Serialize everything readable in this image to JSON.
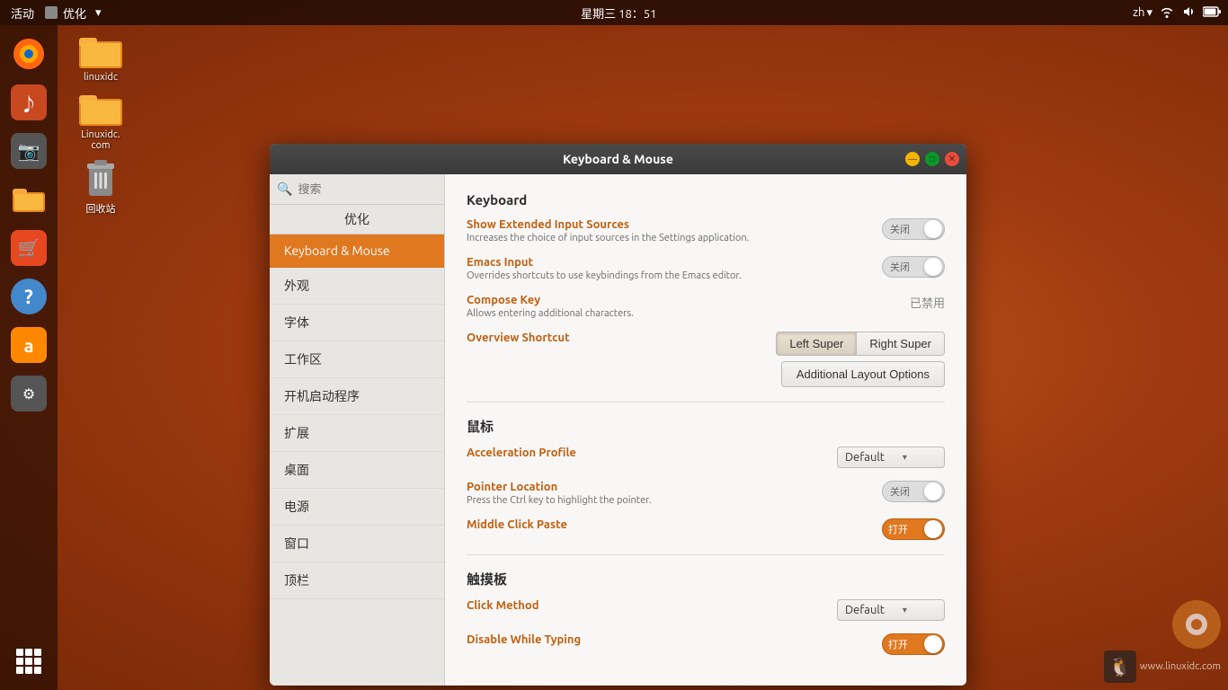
{
  "topbar": {
    "activities": "活动",
    "app_menu": "优化",
    "app_menu_arrow": "▾",
    "datetime": "星期三 18：51",
    "lang": "zh",
    "lang_arrow": "▾",
    "wifi_icon": "wifi",
    "volume_icon": "volume",
    "battery_icon": "battery"
  },
  "dock": {
    "items": [
      {
        "icon": "🦊",
        "label": ""
      },
      {
        "icon": "🔊",
        "label": ""
      },
      {
        "icon": "📷",
        "label": ""
      },
      {
        "icon": "📁",
        "label": ""
      },
      {
        "icon": "🛒",
        "label": ""
      },
      {
        "icon": "❓",
        "label": ""
      },
      {
        "icon": "🅰",
        "label": ""
      },
      {
        "icon": "⚙",
        "label": ""
      },
      {
        "icon": "⋮⋮⋮",
        "label": ""
      }
    ]
  },
  "desktop_icons": [
    {
      "label": "linuxidc",
      "type": "folder"
    },
    {
      "label": "Linuxidc.\ncom",
      "type": "folder"
    },
    {
      "label": "回收站",
      "type": "trash"
    }
  ],
  "dialog": {
    "titlebar": {
      "title": "Keyboard & Mouse"
    },
    "sidebar": {
      "search_placeholder": "搜索",
      "app_name": "优化",
      "nav_items": [
        {
          "id": "keyboard-mouse",
          "label": "Keyboard & Mouse",
          "active": true
        },
        {
          "id": "appearance",
          "label": "外观",
          "active": false
        },
        {
          "id": "fonts",
          "label": "字体",
          "active": false
        },
        {
          "id": "workspaces",
          "label": "工作区",
          "active": false
        },
        {
          "id": "startup",
          "label": "开机启动程序",
          "active": false
        },
        {
          "id": "extensions",
          "label": "扩展",
          "active": false
        },
        {
          "id": "desktop",
          "label": "桌面",
          "active": false
        },
        {
          "id": "power",
          "label": "电源",
          "active": false
        },
        {
          "id": "window",
          "label": "窗口",
          "active": false
        },
        {
          "id": "topbar",
          "label": "顶栏",
          "active": false
        }
      ]
    },
    "content": {
      "keyboard_section": "Keyboard",
      "settings": [
        {
          "id": "show-extended-input",
          "label": "Show Extended Input Sources",
          "desc": "Increases the choice of input sources in the Settings application.",
          "control": "toggle-off",
          "control_label": "关闭"
        },
        {
          "id": "emacs-input",
          "label": "Emacs Input",
          "desc": "Overrides shortcuts to use keybindings from the Emacs editor.",
          "control": "toggle-off",
          "control_label": "关闭"
        },
        {
          "id": "compose-key",
          "label": "Compose Key",
          "desc": "Allows entering additional characters.",
          "control": "disabled-text",
          "control_label": "已禁用"
        },
        {
          "id": "overview-shortcut",
          "label": "Overview Shortcut",
          "desc": "",
          "control": "btn-group",
          "btn_left": "Left Super",
          "btn_right": "Right Super",
          "extra_btn": "Additional Layout Options"
        }
      ],
      "mouse_section": "鼠标",
      "mouse_settings": [
        {
          "id": "acceleration-profile",
          "label": "Acceleration Profile",
          "desc": "",
          "control": "dropdown",
          "value": "Default"
        },
        {
          "id": "pointer-location",
          "label": "Pointer Location",
          "desc": "Press the Ctrl key to highlight the pointer.",
          "control": "toggle-off",
          "control_label": "关闭"
        },
        {
          "id": "middle-click-paste",
          "label": "Middle Click Paste",
          "desc": "",
          "control": "toggle-on",
          "control_label": "打开"
        }
      ],
      "touchpad_section": "触摸板",
      "touchpad_settings": [
        {
          "id": "click-method",
          "label": "Click Method",
          "desc": "",
          "control": "dropdown",
          "value": "Default"
        },
        {
          "id": "disable-while-typing",
          "label": "Disable While Typing",
          "desc": "",
          "control": "toggle-on",
          "control_label": "打开"
        }
      ]
    }
  },
  "watermark": {
    "site": "www.linuxidc.com"
  }
}
